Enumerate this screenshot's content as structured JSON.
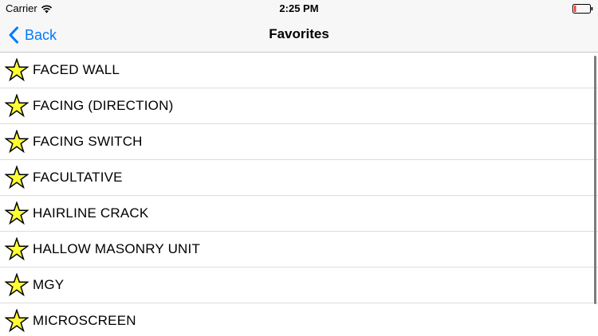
{
  "status_bar": {
    "carrier": "Carrier",
    "time": "2:25 PM",
    "battery_color": "#ff3b30"
  },
  "nav": {
    "back_label": "Back",
    "title": "Favorites",
    "accent_color": "#007aff"
  },
  "favorites": {
    "icon": "star-icon",
    "star_fill": "#ffff33",
    "items": [
      {
        "label": "FACED WALL"
      },
      {
        "label": "FACING (DIRECTION)"
      },
      {
        "label": "FACING SWITCH"
      },
      {
        "label": "FACULTATIVE"
      },
      {
        "label": "HAIRLINE CRACK"
      },
      {
        "label": "HALLOW MASONRY UNIT"
      },
      {
        "label": "MGY"
      },
      {
        "label": "MICROSCREEN"
      }
    ]
  }
}
